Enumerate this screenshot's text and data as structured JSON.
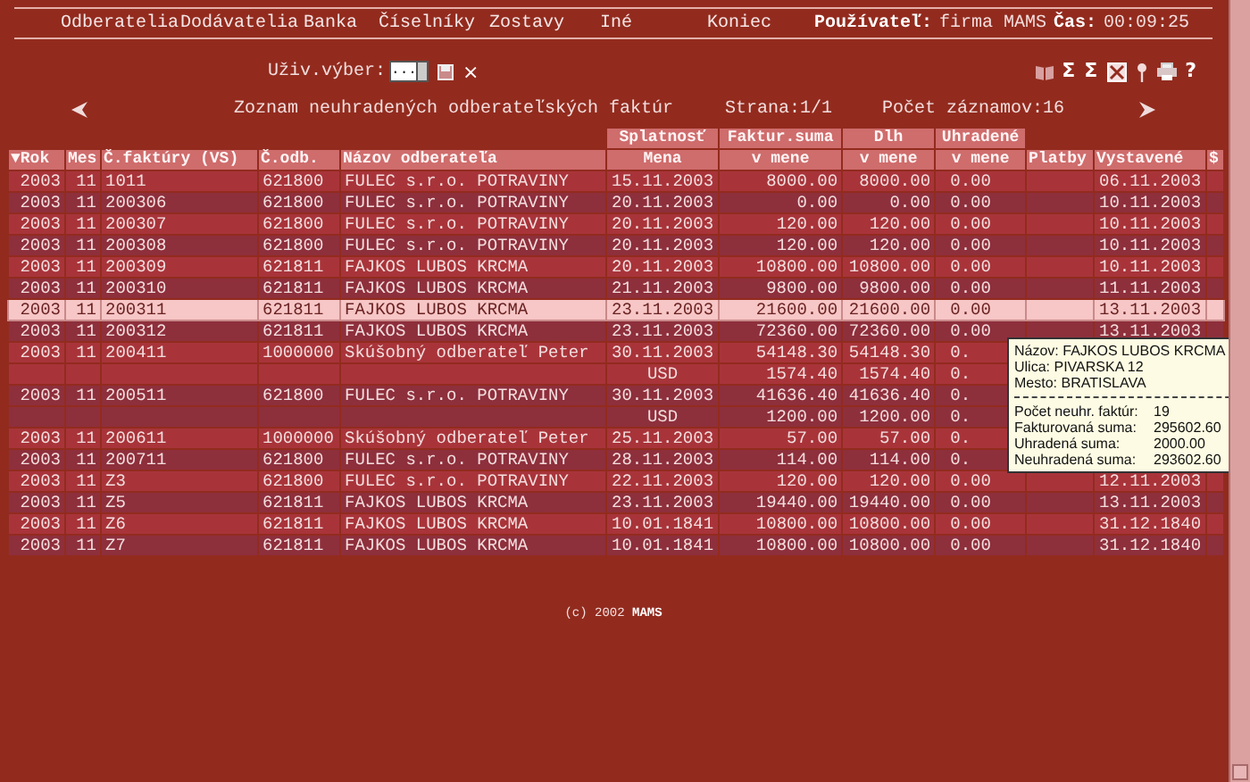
{
  "menu": [
    {
      "label": "Odberatelia"
    },
    {
      "label": "Dodávatelia"
    },
    {
      "label": "Banka"
    },
    {
      "label": "Číselníky"
    },
    {
      "label": "Zostavy"
    },
    {
      "label": "Iné"
    },
    {
      "label": "Koniec"
    }
  ],
  "session": {
    "user_label": "Používateľ:",
    "user": "firma MAMS",
    "time_label": "Čas:",
    "time": "00:09:25"
  },
  "toolbar": {
    "filter_label": "Uživ.výber:",
    "filter_value": "...",
    "delete": "×",
    "tools": [
      {
        "kind": "book"
      },
      {
        "kind": "glyph",
        "label": "Σ"
      },
      {
        "kind": "glyph",
        "label": "Σ"
      },
      {
        "kind": "sheet"
      },
      {
        "kind": "pin"
      },
      {
        "kind": "printer"
      },
      {
        "kind": "glyph",
        "label": "?"
      }
    ]
  },
  "nav": {
    "title": "Zoznam neuhradených odberateľských faktúr",
    "page": "Strana:1/1",
    "count": "Počet záznamov:16"
  },
  "table": {
    "groups": [
      "Splatnosť",
      "Faktur.suma",
      "Dlh",
      "Uhradené"
    ],
    "columns": [
      {
        "label": "Rok",
        "sort_glyph": "▼"
      },
      {
        "label": "Mes"
      },
      {
        "label": "Č.faktúry (VS)"
      },
      {
        "label": "Č.odb."
      },
      {
        "label": "Názov odberateľa"
      },
      {
        "label": "Mena"
      },
      {
        "label": "v mene"
      },
      {
        "label": "v mene"
      },
      {
        "label": "v mene"
      },
      {
        "label": "Platby"
      },
      {
        "label": "Vystavené"
      },
      {
        "label": "$"
      }
    ],
    "rows": [
      {
        "kind": "invoice",
        "selected": false,
        "rok": "2003",
        "mes": "11",
        "faktura": "1011",
        "odb": "621800",
        "nazov": "FULEC s.r.o. POTRAVINY",
        "splatnost": "15.11.2003",
        "suma": "8000.00",
        "dlh": "8000.00",
        "uhradene": "0.00",
        "vystavene": "06.11.2003"
      },
      {
        "kind": "invoice",
        "selected": false,
        "rok": "2003",
        "mes": "11",
        "faktura": "200306",
        "odb": "621800",
        "nazov": "FULEC s.r.o. POTRAVINY",
        "splatnost": "20.11.2003",
        "suma": "0.00",
        "dlh": "0.00",
        "uhradene": "0.00",
        "vystavene": "10.11.2003"
      },
      {
        "kind": "invoice",
        "selected": false,
        "rok": "2003",
        "mes": "11",
        "faktura": "200307",
        "odb": "621800",
        "nazov": "FULEC s.r.o. POTRAVINY",
        "splatnost": "20.11.2003",
        "suma": "120.00",
        "dlh": "120.00",
        "uhradene": "0.00",
        "vystavene": "10.11.2003"
      },
      {
        "kind": "invoice",
        "selected": false,
        "rok": "2003",
        "mes": "11",
        "faktura": "200308",
        "odb": "621800",
        "nazov": "FULEC s.r.o. POTRAVINY",
        "splatnost": "20.11.2003",
        "suma": "120.00",
        "dlh": "120.00",
        "uhradene": "0.00",
        "vystavene": "10.11.2003"
      },
      {
        "kind": "invoice",
        "selected": false,
        "rok": "2003",
        "mes": "11",
        "faktura": "200309",
        "odb": "621811",
        "nazov": "FAJKOS LUBOS KRCMA",
        "splatnost": "20.11.2003",
        "suma": "10800.00",
        "dlh": "10800.00",
        "uhradene": "0.00",
        "vystavene": "10.11.2003"
      },
      {
        "kind": "invoice",
        "selected": false,
        "rok": "2003",
        "mes": "11",
        "faktura": "200310",
        "odb": "621811",
        "nazov": "FAJKOS LUBOS KRCMA",
        "splatnost": "21.11.2003",
        "suma": "9800.00",
        "dlh": "9800.00",
        "uhradene": "0.00",
        "vystavene": "11.11.2003"
      },
      {
        "kind": "invoice",
        "selected": true,
        "rok": "2003",
        "mes": "11",
        "faktura": "200311",
        "odb": "621811",
        "nazov": "FAJKOS LUBOS KRCMA",
        "splatnost": "23.11.2003",
        "suma": "21600.00",
        "dlh": "21600.00",
        "uhradene": "0.00",
        "vystavene": "13.11.2003"
      },
      {
        "kind": "invoice",
        "selected": false,
        "rok": "2003",
        "mes": "11",
        "faktura": "200312",
        "odb": "621811",
        "nazov": "FAJKOS LUBOS KRCMA",
        "splatnost": "23.11.2003",
        "suma": "72360.00",
        "dlh": "72360.00",
        "uhradene": "0.00",
        "vystavene": "13.11.2003"
      },
      {
        "kind": "invoice",
        "selected": false,
        "rok": "2003",
        "mes": "11",
        "faktura": "200411",
        "odb": "1000000",
        "nazov": "Skúšobný odberateľ Peter",
        "splatnost": "30.11.2003",
        "suma": "54148.30",
        "dlh": "54148.30",
        "uhradene": "0."
      },
      {
        "kind": "currency",
        "selected": false,
        "mena": "USD",
        "suma": "1574.40",
        "dlh": "1574.40",
        "uhradene": "0."
      },
      {
        "kind": "invoice",
        "selected": false,
        "rok": "2003",
        "mes": "11",
        "faktura": "200511",
        "odb": "621800",
        "nazov": "FULEC s.r.o. POTRAVINY",
        "splatnost": "30.11.2003",
        "suma": "41636.40",
        "dlh": "41636.40",
        "uhradene": "0."
      },
      {
        "kind": "currency",
        "selected": false,
        "mena": "USD",
        "suma": "1200.00",
        "dlh": "1200.00",
        "uhradene": "0."
      },
      {
        "kind": "invoice",
        "selected": false,
        "rok": "2003",
        "mes": "11",
        "faktura": "200611",
        "odb": "1000000",
        "nazov": "Skúšobný odberateľ Peter",
        "splatnost": "25.11.2003",
        "suma": "57.00",
        "dlh": "57.00",
        "uhradene": "0."
      },
      {
        "kind": "invoice",
        "selected": false,
        "rok": "2003",
        "mes": "11",
        "faktura": "200711",
        "odb": "621800",
        "nazov": "FULEC s.r.o. POTRAVINY",
        "splatnost": "28.11.2003",
        "suma": "114.00",
        "dlh": "114.00",
        "uhradene": "0."
      },
      {
        "kind": "invoice",
        "selected": false,
        "rok": "2003",
        "mes": "11",
        "faktura": "Z3",
        "odb": "621800",
        "nazov": "FULEC s.r.o. POTRAVINY",
        "splatnost": "22.11.2003",
        "suma": "120.00",
        "dlh": "120.00",
        "uhradene": "0.00",
        "vystavene": "12.11.2003"
      },
      {
        "kind": "invoice",
        "selected": false,
        "rok": "2003",
        "mes": "11",
        "faktura": "Z5",
        "odb": "621811",
        "nazov": "FAJKOS LUBOS KRCMA",
        "splatnost": "23.11.2003",
        "suma": "19440.00",
        "dlh": "19440.00",
        "uhradene": "0.00",
        "vystavene": "13.11.2003"
      },
      {
        "kind": "invoice",
        "selected": false,
        "rok": "2003",
        "mes": "11",
        "faktura": "Z6",
        "odb": "621811",
        "nazov": "FAJKOS LUBOS KRCMA",
        "splatnost": "10.01.1841",
        "suma": "10800.00",
        "dlh": "10800.00",
        "uhradene": "0.00",
        "vystavene": "31.12.1840"
      },
      {
        "kind": "invoice",
        "selected": false,
        "rok": "2003",
        "mes": "11",
        "faktura": "Z7",
        "odb": "621811",
        "nazov": "FAJKOS LUBOS KRCMA",
        "splatnost": "10.01.1841",
        "suma": "10800.00",
        "dlh": "10800.00",
        "uhradene": "0.00",
        "vystavene": "31.12.1840"
      }
    ]
  },
  "tooltip": {
    "lines": [
      "Názov: FAJKOS LUBOS KRCMA",
      "Ulica: PIVARSKA 12",
      "Mesto: BRATISLAVA"
    ],
    "stats": [
      {
        "label": "Počet neuhr. faktúr:",
        "value": "19"
      },
      {
        "label": "Fakturovaná suma:",
        "value": "295602.60"
      },
      {
        "label": "Uhradená suma:",
        "value": "2000.00"
      },
      {
        "label": "Neuhradená suma:",
        "value": "293602.60"
      }
    ]
  },
  "footer": {
    "text": "(c) 2002",
    "brand": "MAMS"
  }
}
